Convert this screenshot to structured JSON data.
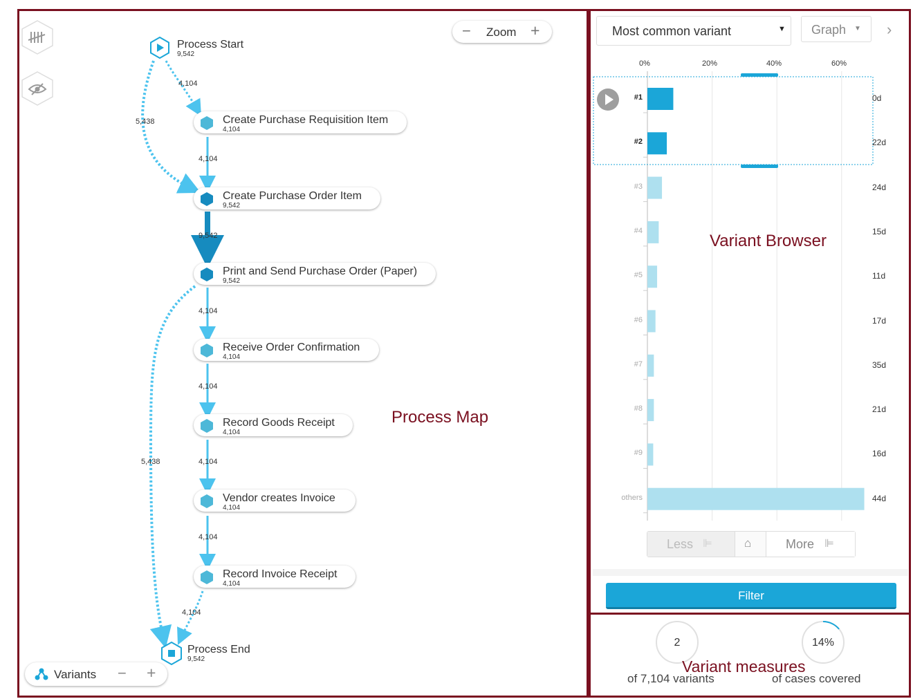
{
  "process_map": {
    "zoom_label": "Zoom",
    "variants_label": "Variants",
    "annotation": "Process Map",
    "nodes": [
      {
        "label": "Process Start",
        "count": "9,542"
      },
      {
        "label": "Create Purchase Requisition Item",
        "count": "4,104"
      },
      {
        "label": "Create Purchase Order Item",
        "count": "9,542"
      },
      {
        "label": "Print and Send Purchase Order (Paper)",
        "count": "9,542"
      },
      {
        "label": "Receive Order Confirmation",
        "count": "4,104"
      },
      {
        "label": "Record Goods Receipt",
        "count": "4,104"
      },
      {
        "label": "Vendor creates Invoice",
        "count": "4,104"
      },
      {
        "label": "Record Invoice Receipt",
        "count": "4,104"
      },
      {
        "label": "Process End",
        "count": "9,542"
      }
    ],
    "edges": [
      {
        "from": "Process Start",
        "to": "Create Purchase Requisition Item",
        "label": "4,104"
      },
      {
        "from": "Process Start",
        "to": "Create Purchase Order Item",
        "label": "5,438"
      },
      {
        "from": "Create Purchase Requisition Item",
        "to": "Create Purchase Order Item",
        "label": "4,104"
      },
      {
        "from": "Create Purchase Order Item",
        "to": "Print and Send Purchase Order (Paper)",
        "label": "9,542"
      },
      {
        "from": "Print and Send Purchase Order (Paper)",
        "to": "Receive Order Confirmation",
        "label": "4,104"
      },
      {
        "from": "Receive Order Confirmation",
        "to": "Record Goods Receipt",
        "label": "4,104"
      },
      {
        "from": "Print and Send Purchase Order (Paper)",
        "to": "Process End",
        "label": "5,438"
      },
      {
        "from": "Record Goods Receipt",
        "to": "Vendor creates Invoice",
        "label": "4,104"
      },
      {
        "from": "Vendor creates Invoice",
        "to": "Record Invoice Receipt",
        "label": "4,104"
      },
      {
        "from": "Record Invoice Receipt",
        "to": "Process End",
        "label": "4,104"
      }
    ]
  },
  "variant_browser": {
    "annotation": "Variant Browser",
    "dropdown_value": "Most common variant",
    "view_button": "Graph",
    "axis_ticks": [
      "0%",
      "20%",
      "40%",
      "60%"
    ],
    "less_label": "Less",
    "more_label": "More",
    "filter_label": "Filter",
    "colors": {
      "selected": "#1ba6d8",
      "unselected": "#aee0ef",
      "accent": "#1ba6d8"
    }
  },
  "chart_data": {
    "type": "bar",
    "orientation": "horizontal",
    "categories": [
      "#1",
      "#2",
      "#3",
      "#4",
      "#5",
      "#6",
      "#7",
      "#8",
      "#9",
      "others"
    ],
    "values": [
      8,
      6,
      4.5,
      3.5,
      3,
      2.5,
      2,
      2,
      1.8,
      67
    ],
    "durations": [
      "0d",
      "22d",
      "24d",
      "15d",
      "11d",
      "17d",
      "35d",
      "21d",
      "16d",
      "44d"
    ],
    "selected": [
      true,
      true,
      false,
      false,
      false,
      false,
      false,
      false,
      false,
      false
    ],
    "xlim": [
      0,
      70
    ],
    "grid": true
  },
  "measures": {
    "annotation": "Variant measures",
    "variants_value": "2",
    "variants_caption": "of 7,104 variants",
    "coverage_value": "14%",
    "coverage_fraction": 0.14,
    "coverage_caption": "of cases covered"
  }
}
